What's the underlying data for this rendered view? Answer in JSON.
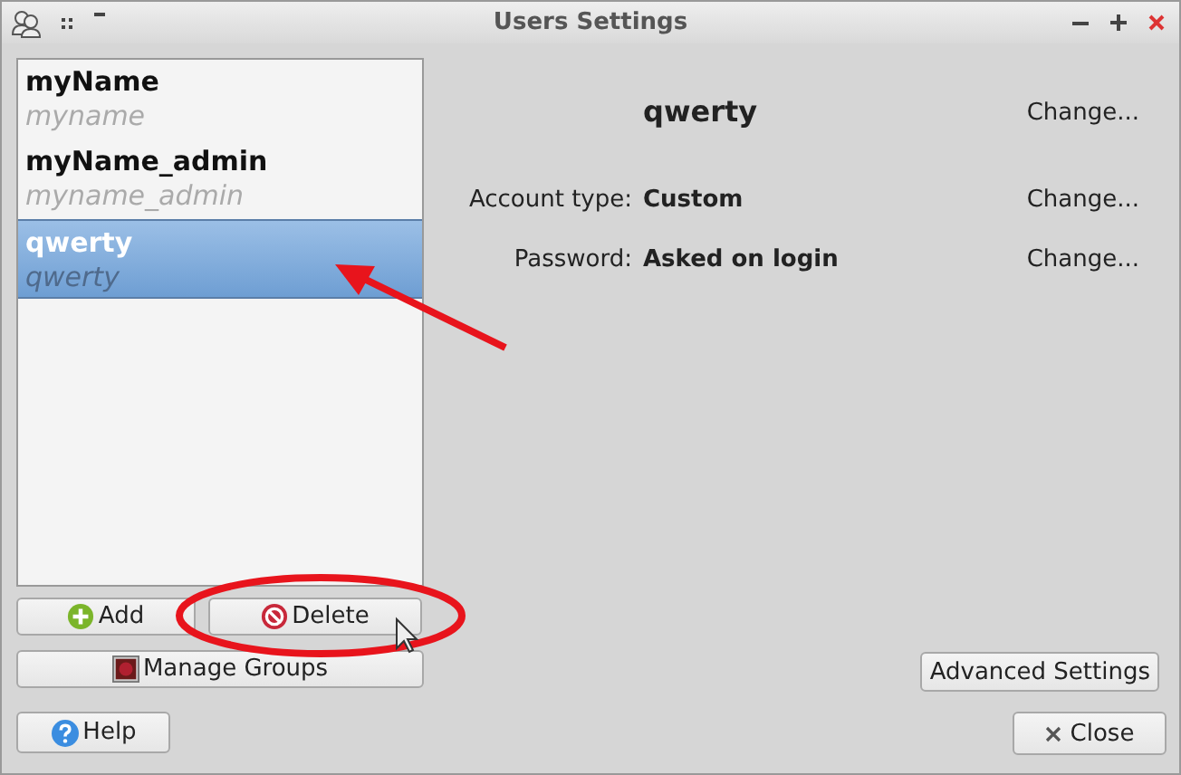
{
  "window": {
    "title": "Users Settings"
  },
  "users": [
    {
      "name": "myName",
      "login": "myname",
      "selected": false
    },
    {
      "name": "myName_admin",
      "login": "myname_admin",
      "selected": false
    },
    {
      "name": "qwerty",
      "login": "qwerty",
      "selected": true
    }
  ],
  "details": {
    "name": "qwerty",
    "name_action": "Change...",
    "fields": [
      {
        "label": "Account type:",
        "value": "Custom",
        "action": "Change..."
      },
      {
        "label": "Password:",
        "value": "Asked on login",
        "action": "Change..."
      }
    ]
  },
  "list_buttons": [
    {
      "label": "Add",
      "kind": "add"
    },
    {
      "label": "Delete",
      "kind": "delete"
    }
  ],
  "manage_groups": "Manage Groups",
  "advanced": "Advanced Settings",
  "help": "Help",
  "close": "Close"
}
